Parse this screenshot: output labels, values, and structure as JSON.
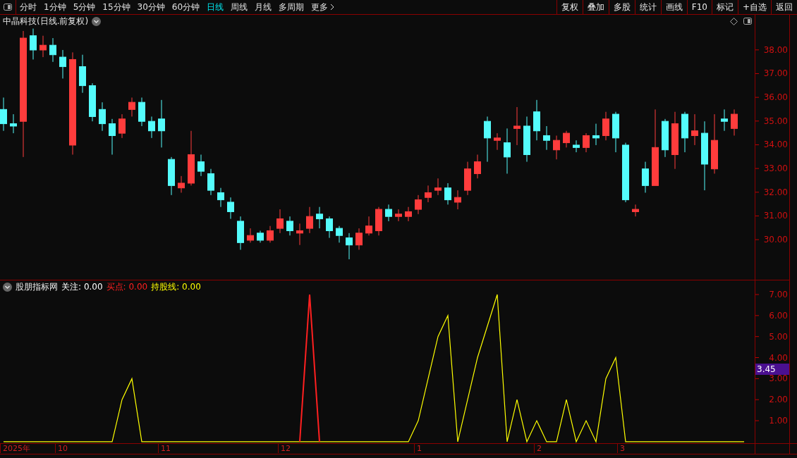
{
  "toolbar": {
    "periods": [
      {
        "label": "分时",
        "selected": false
      },
      {
        "label": "1分钟",
        "selected": false
      },
      {
        "label": "5分钟",
        "selected": false
      },
      {
        "label": "15分钟",
        "selected": false
      },
      {
        "label": "30分钟",
        "selected": false
      },
      {
        "label": "60分钟",
        "selected": false
      },
      {
        "label": "日线",
        "selected": true
      },
      {
        "label": "周线",
        "selected": false
      },
      {
        "label": "月线",
        "selected": false
      },
      {
        "label": "多周期",
        "selected": false
      },
      {
        "label": "更多",
        "selected": false
      }
    ],
    "actions": [
      "复权",
      "叠加",
      "多股",
      "统计",
      "画线",
      "F10",
      "标记",
      "+自选",
      "返回"
    ]
  },
  "price_pane": {
    "title": "中晶科技(日线.前复权)",
    "chart_data": {
      "type": "candlestick",
      "categories": [
        null,
        null,
        null,
        null,
        null,
        null,
        null,
        null,
        null,
        null,
        null,
        null,
        null,
        null,
        null,
        null,
        null,
        null,
        null,
        null,
        null,
        null,
        null,
        null,
        null,
        null,
        null,
        null,
        null,
        null,
        null,
        null,
        null,
        null,
        null,
        null,
        null,
        null,
        null,
        null,
        null,
        null,
        null,
        null,
        null,
        null,
        null,
        null,
        null,
        null,
        null,
        null,
        null,
        null,
        null,
        null,
        null,
        null,
        null,
        null,
        null,
        null,
        null,
        null,
        null,
        null,
        null,
        null,
        null,
        null,
        null,
        null,
        null,
        null,
        null
      ],
      "ylim": [
        28.31,
        39.48
      ],
      "yticks": [
        {
          "value": 30,
          "label": "30.00"
        },
        {
          "value": 31,
          "label": "31.00"
        },
        {
          "value": 32,
          "label": "32.00"
        },
        {
          "value": 33,
          "label": "33.00"
        },
        {
          "value": 34,
          "label": "34.00"
        },
        {
          "value": 35,
          "label": "35.00"
        },
        {
          "value": 36,
          "label": "36.00"
        },
        {
          "value": 37,
          "label": "37.00"
        },
        {
          "value": 38,
          "label": "38.00"
        }
      ],
      "ohlc": [
        [
          35.5,
          36.0,
          34.6,
          34.9
        ],
        [
          34.9,
          35.3,
          34.5,
          34.8
        ],
        [
          35.0,
          38.8,
          33.5,
          38.5
        ],
        [
          38.6,
          38.9,
          37.6,
          38.0
        ],
        [
          38.0,
          38.6,
          37.7,
          38.2
        ],
        [
          38.2,
          38.5,
          37.5,
          37.8
        ],
        [
          37.7,
          38.0,
          36.8,
          37.3
        ],
        [
          34.0,
          37.9,
          33.6,
          37.6
        ],
        [
          37.3,
          37.8,
          36.2,
          36.5
        ],
        [
          36.5,
          36.6,
          35.0,
          35.2
        ],
        [
          35.5,
          35.8,
          34.6,
          34.9
        ],
        [
          34.9,
          35.1,
          33.6,
          34.4
        ],
        [
          34.5,
          35.3,
          34.3,
          35.1
        ],
        [
          35.5,
          36.0,
          35.2,
          35.8
        ],
        [
          35.8,
          36.0,
          34.8,
          35.0
        ],
        [
          35.0,
          35.2,
          34.3,
          34.6
        ],
        [
          35.1,
          35.9,
          33.9,
          34.6
        ],
        [
          33.4,
          33.5,
          31.9,
          32.3
        ],
        [
          32.2,
          32.7,
          32.0,
          32.4
        ],
        [
          32.4,
          34.6,
          32.3,
          33.6
        ],
        [
          33.3,
          33.6,
          32.7,
          32.9
        ],
        [
          32.8,
          33.0,
          31.9,
          32.1
        ],
        [
          32.0,
          32.2,
          31.4,
          31.7
        ],
        [
          31.6,
          31.8,
          30.9,
          31.2
        ],
        [
          30.8,
          31.0,
          29.6,
          29.9
        ],
        [
          30.0,
          30.5,
          29.9,
          30.2
        ],
        [
          30.3,
          30.4,
          29.9,
          30.0
        ],
        [
          30.0,
          30.6,
          29.9,
          30.4
        ],
        [
          30.5,
          31.3,
          30.3,
          30.9
        ],
        [
          30.8,
          31.0,
          30.2,
          30.4
        ],
        [
          30.3,
          30.7,
          29.8,
          30.4
        ],
        [
          30.5,
          31.4,
          30.3,
          31.0
        ],
        [
          31.1,
          31.4,
          30.5,
          30.9
        ],
        [
          30.9,
          31.0,
          30.1,
          30.4
        ],
        [
          30.5,
          30.6,
          29.9,
          30.2
        ],
        [
          30.1,
          30.3,
          29.2,
          29.8
        ],
        [
          29.8,
          30.5,
          29.6,
          30.3
        ],
        [
          30.3,
          31.0,
          30.2,
          30.6
        ],
        [
          30.4,
          31.4,
          30.2,
          31.3
        ],
        [
          31.3,
          31.5,
          30.8,
          31.0
        ],
        [
          31.0,
          31.3,
          30.8,
          31.1
        ],
        [
          31.0,
          31.4,
          30.8,
          31.2
        ],
        [
          31.3,
          31.9,
          31.1,
          31.7
        ],
        [
          31.8,
          32.3,
          31.6,
          32.0
        ],
        [
          32.1,
          32.6,
          31.9,
          32.2
        ],
        [
          32.2,
          32.4,
          31.5,
          31.7
        ],
        [
          31.6,
          32.1,
          31.3,
          31.8
        ],
        [
          32.1,
          33.3,
          31.9,
          33.0
        ],
        [
          32.8,
          33.6,
          32.6,
          33.3
        ],
        [
          35.0,
          35.2,
          33.3,
          34.3
        ],
        [
          34.2,
          34.5,
          33.8,
          34.3
        ],
        [
          34.1,
          34.7,
          32.8,
          33.5
        ],
        [
          34.7,
          35.6,
          34.0,
          34.8
        ],
        [
          34.8,
          35.2,
          33.3,
          33.6
        ],
        [
          35.4,
          35.9,
          34.2,
          34.6
        ],
        [
          34.4,
          34.8,
          33.8,
          34.2
        ],
        [
          33.8,
          34.4,
          33.4,
          34.2
        ],
        [
          34.1,
          34.6,
          33.9,
          34.5
        ],
        [
          34.0,
          34.2,
          33.7,
          33.9
        ],
        [
          33.9,
          34.5,
          33.7,
          34.4
        ],
        [
          34.4,
          34.9,
          34.0,
          34.3
        ],
        [
          34.4,
          35.4,
          34.2,
          35.1
        ],
        [
          35.3,
          35.4,
          33.7,
          34.3
        ],
        [
          34.0,
          34.1,
          31.6,
          31.7
        ],
        [
          31.2,
          31.5,
          31.0,
          31.3
        ],
        [
          33.0,
          33.3,
          32.0,
          32.3
        ],
        [
          32.3,
          35.5,
          32.3,
          33.9
        ],
        [
          35.0,
          35.1,
          33.5,
          33.8
        ],
        [
          33.6,
          35.4,
          33.0,
          34.9
        ],
        [
          35.3,
          35.4,
          33.7,
          34.3
        ],
        [
          34.4,
          35.3,
          34.0,
          34.6
        ],
        [
          34.5,
          35.0,
          32.1,
          33.2
        ],
        [
          33.0,
          35.3,
          32.8,
          34.2
        ],
        [
          35.1,
          35.5,
          34.6,
          35.0
        ],
        [
          34.7,
          35.5,
          34.4,
          35.3
        ]
      ]
    }
  },
  "indicator_pane": {
    "name": "股朋指标网",
    "legend": [
      {
        "label": "关注:",
        "value": "0.00",
        "color": "#ffffff"
      },
      {
        "label": "买点:",
        "value": "0.00",
        "color": "#ff2020"
      },
      {
        "label": "持股线:",
        "value": "0.00",
        "color": "#ffff00"
      }
    ],
    "cursor_value": "3.45",
    "date_axis": [
      "2025年",
      "10",
      "11",
      "12",
      "1",
      "2",
      "3"
    ],
    "chart_data": {
      "type": "line",
      "ylim": [
        -0.07,
        7.67
      ],
      "yticks": [
        {
          "value": 1,
          "label": "1.00"
        },
        {
          "value": 2,
          "label": "2.00"
        },
        {
          "value": 3,
          "label": "3.00"
        },
        {
          "value": 4,
          "label": "4.00"
        },
        {
          "value": 5,
          "label": "5.00"
        },
        {
          "value": 6,
          "label": "6.00"
        },
        {
          "value": 7,
          "label": "7.00"
        }
      ],
      "categories": [
        null,
        null,
        null,
        null,
        null,
        null,
        null,
        null,
        null,
        null,
        null,
        null,
        null,
        null,
        null,
        null,
        null,
        null,
        null,
        null,
        null,
        null,
        null,
        null,
        null,
        null,
        null,
        null,
        null,
        null,
        null,
        null,
        null,
        null,
        null,
        null,
        null,
        null,
        null,
        null,
        null,
        null,
        null,
        null,
        null,
        null,
        null,
        null,
        null,
        null,
        null,
        null,
        null,
        null,
        null,
        null,
        null,
        null,
        null,
        null,
        null,
        null,
        null,
        null,
        null,
        null,
        null,
        null,
        null,
        null,
        null,
        null,
        null,
        null,
        null,
        null
      ],
      "series": [
        {
          "color": "#ffff00",
          "values": [
            0,
            0,
            0,
            0,
            0,
            0,
            0,
            0,
            0,
            0,
            0,
            0,
            2,
            3,
            0,
            0,
            0,
            0,
            0,
            0,
            0,
            0,
            0,
            0,
            0,
            0,
            0,
            0,
            0,
            0,
            0,
            0,
            0,
            0,
            0,
            0,
            0,
            0,
            0,
            0,
            0,
            0,
            1,
            3,
            5,
            6,
            0,
            2,
            4,
            5.5,
            7,
            0,
            2,
            0,
            1,
            0,
            0,
            2,
            0,
            1,
            0,
            3,
            4,
            0,
            0,
            0,
            0,
            0,
            0,
            0,
            0,
            0,
            0,
            0,
            0,
            0
          ]
        },
        {
          "color": "#ff2020",
          "values": [
            null,
            null,
            null,
            null,
            null,
            null,
            null,
            null,
            null,
            null,
            null,
            null,
            null,
            null,
            null,
            null,
            null,
            null,
            null,
            null,
            null,
            null,
            null,
            null,
            null,
            null,
            null,
            null,
            null,
            null,
            0,
            7,
            0,
            null,
            null,
            null,
            null,
            null,
            null,
            null,
            null,
            null,
            null,
            null,
            null,
            null,
            null,
            null,
            null,
            null,
            null,
            null,
            null,
            null,
            null,
            null,
            null,
            null,
            null,
            null,
            null,
            null,
            null,
            null,
            null,
            null,
            null,
            null,
            null,
            null,
            null,
            null,
            null,
            null,
            null,
            null
          ]
        }
      ]
    }
  }
}
